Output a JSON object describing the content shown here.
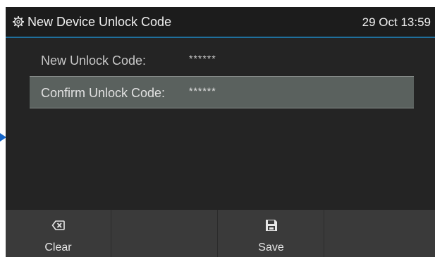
{
  "header": {
    "icon": "gear-icon",
    "title": "New Device Unlock Code",
    "datetime": "29 Oct 13:59"
  },
  "form": {
    "rows": [
      {
        "label": "New Unlock Code:",
        "value": "******",
        "selected": false
      },
      {
        "label": "Confirm Unlock Code:",
        "value": "******",
        "selected": true
      }
    ]
  },
  "softkeys": [
    {
      "label": "Clear",
      "icon": "backspace-icon"
    },
    {
      "label": "",
      "icon": ""
    },
    {
      "label": "Save",
      "icon": "save-icon"
    },
    {
      "label": "",
      "icon": ""
    }
  ],
  "colors": {
    "background": "#242424",
    "accent": "#1f6f9c",
    "selected_row": "#5a615e",
    "softkey_bar": "#3a3a3a",
    "pointer": "#1565c8"
  }
}
